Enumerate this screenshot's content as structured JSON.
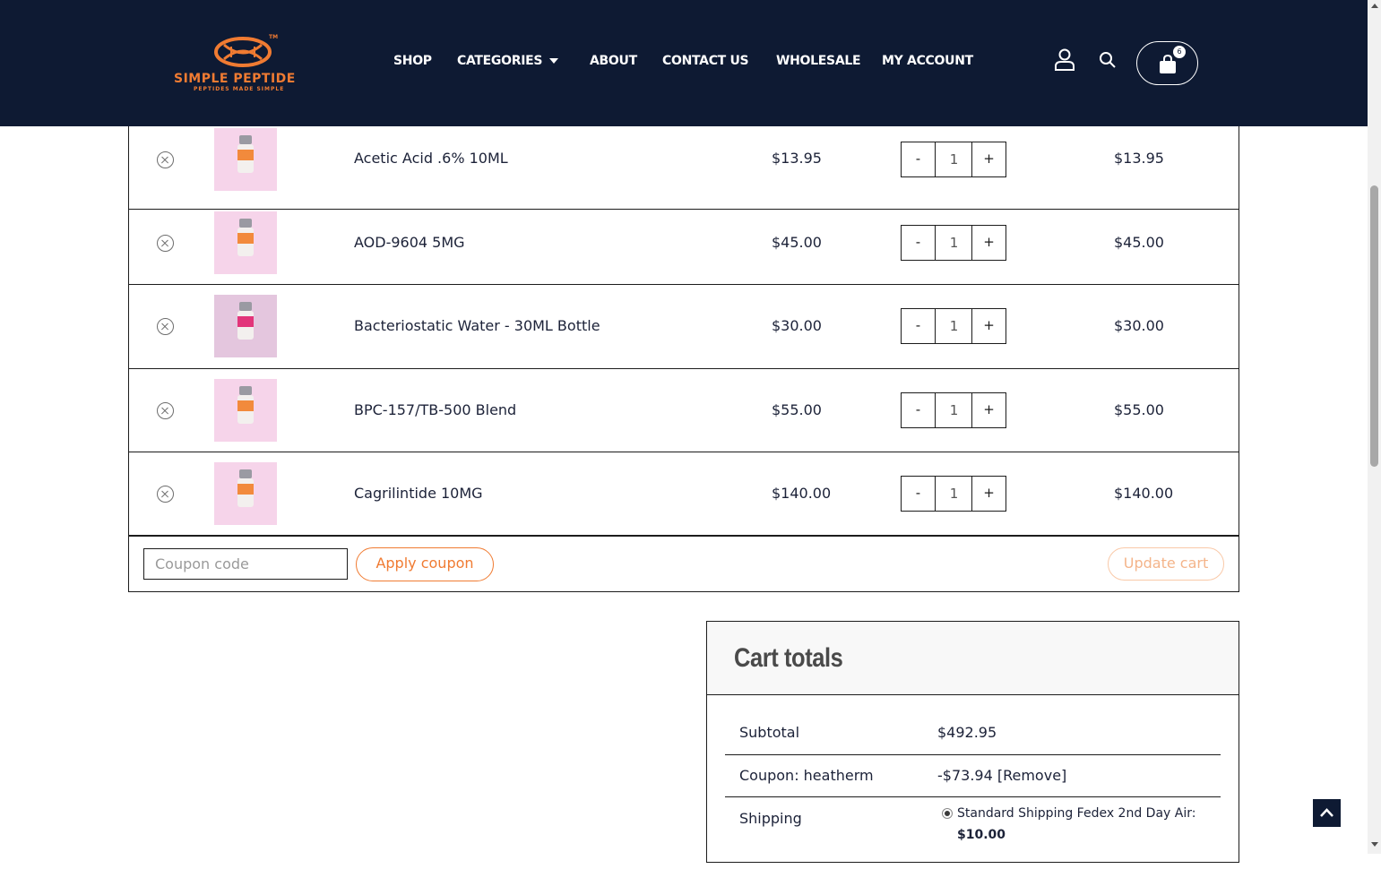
{
  "brand": {
    "name": "SIMPLE PEPTIDE",
    "tagline": "PEPTIDES MADE SIMPLE",
    "tm": "TM",
    "accent_color": "#f07b32",
    "header_bg": "#0e1a33"
  },
  "nav": {
    "items": [
      {
        "label": "SHOP"
      },
      {
        "label": "CATEGORIES"
      },
      {
        "label": "ABOUT"
      },
      {
        "label": "CONTACT US"
      },
      {
        "label": "WHOLESALE"
      },
      {
        "label": "MY ACCOUNT"
      }
    ],
    "icons": [
      "user-icon",
      "search-icon",
      "cart-icon"
    ],
    "cart_count": "6"
  },
  "cart": {
    "items": [
      {
        "name": "Acetic Acid .6% 10ML",
        "price": "$13.95",
        "qty": "1",
        "subtotal": "$13.95"
      },
      {
        "name": "AOD-9604 5MG",
        "price": "$45.00",
        "qty": "1",
        "subtotal": "$45.00"
      },
      {
        "name": "Bacteriostatic Water - 30ML Bottle",
        "price": "$30.00",
        "qty": "1",
        "subtotal": "$30.00"
      },
      {
        "name": "BPC-157/TB-500 Blend",
        "price": "$55.00",
        "qty": "1",
        "subtotal": "$55.00"
      },
      {
        "name": "Cagrilintide 10MG",
        "price": "$140.00",
        "qty": "1",
        "subtotal": "$140.00"
      }
    ],
    "qty_minus": "-",
    "qty_plus": "+",
    "coupon_placeholder": "Coupon code",
    "apply_coupon": "Apply coupon",
    "update_cart": "Update cart"
  },
  "totals": {
    "title": "Cart totals",
    "subtotal_label": "Subtotal",
    "subtotal_value": "$492.95",
    "coupon_label": "Coupon: heatherm",
    "coupon_value": "-$73.94",
    "coupon_remove": "[Remove]",
    "shipping_label": "Shipping",
    "shipping_option": "Standard Shipping Fedex 2nd Day Air:",
    "shipping_price": "$10.00"
  }
}
